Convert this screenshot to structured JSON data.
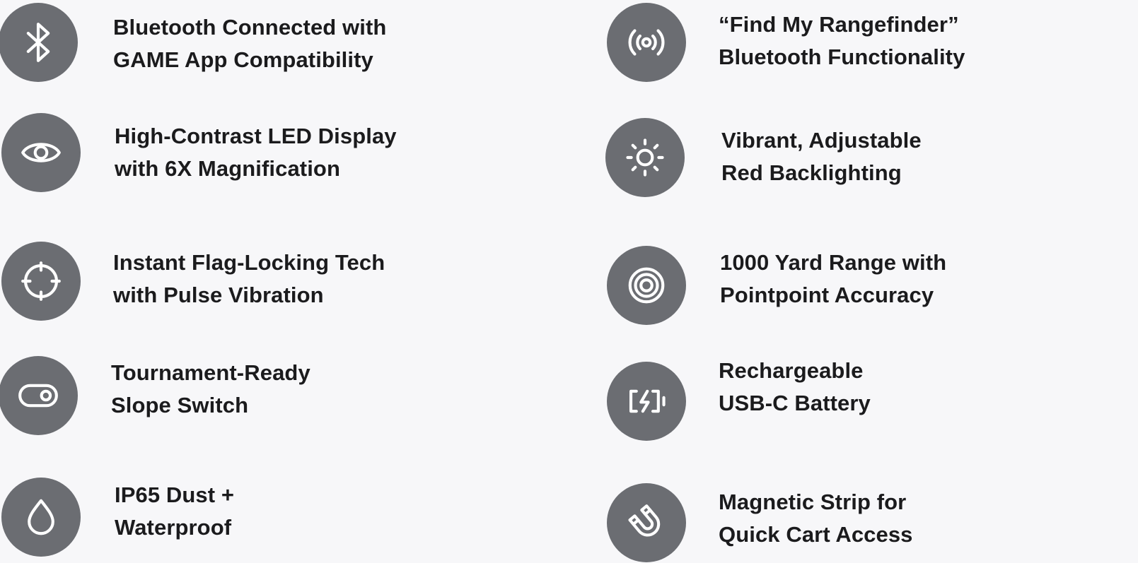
{
  "colors": {
    "background": "#f7f7f9",
    "icon_circle": "#6b6d72",
    "icon_stroke": "#ffffff",
    "text": "#1b1b1d"
  },
  "features": [
    {
      "icon": "bluetooth-icon",
      "line1": "Bluetooth Connected with",
      "line2": "GAME App Compatibility"
    },
    {
      "icon": "broadcast-signal-icon",
      "line1": "“Find My Rangefinder”",
      "line2": "Bluetooth Functionality"
    },
    {
      "icon": "eye-icon",
      "line1": "High-Contrast LED Display",
      "line2": "with 6X Magnification"
    },
    {
      "icon": "sun-brightness-icon",
      "line1": "Vibrant, Adjustable",
      "line2": "Red Backlighting"
    },
    {
      "icon": "crosshair-icon",
      "line1": "Instant Flag-Locking Tech",
      "line2": "with Pulse Vibration"
    },
    {
      "icon": "target-icon",
      "line1": "1000 Yard Range with",
      "line2": "Pointpoint Accuracy"
    },
    {
      "icon": "toggle-switch-icon",
      "line1": "Tournament-Ready",
      "line2": "Slope Switch"
    },
    {
      "icon": "charging-battery-icon",
      "line1": "Rechargeable",
      "line2": "USB-C Battery"
    },
    {
      "icon": "water-drop-icon",
      "line1": "IP65 Dust +",
      "line2": "Waterproof"
    },
    {
      "icon": "magnet-icon",
      "line1": "Magnetic Strip for",
      "line2": "Quick Cart Access"
    }
  ]
}
